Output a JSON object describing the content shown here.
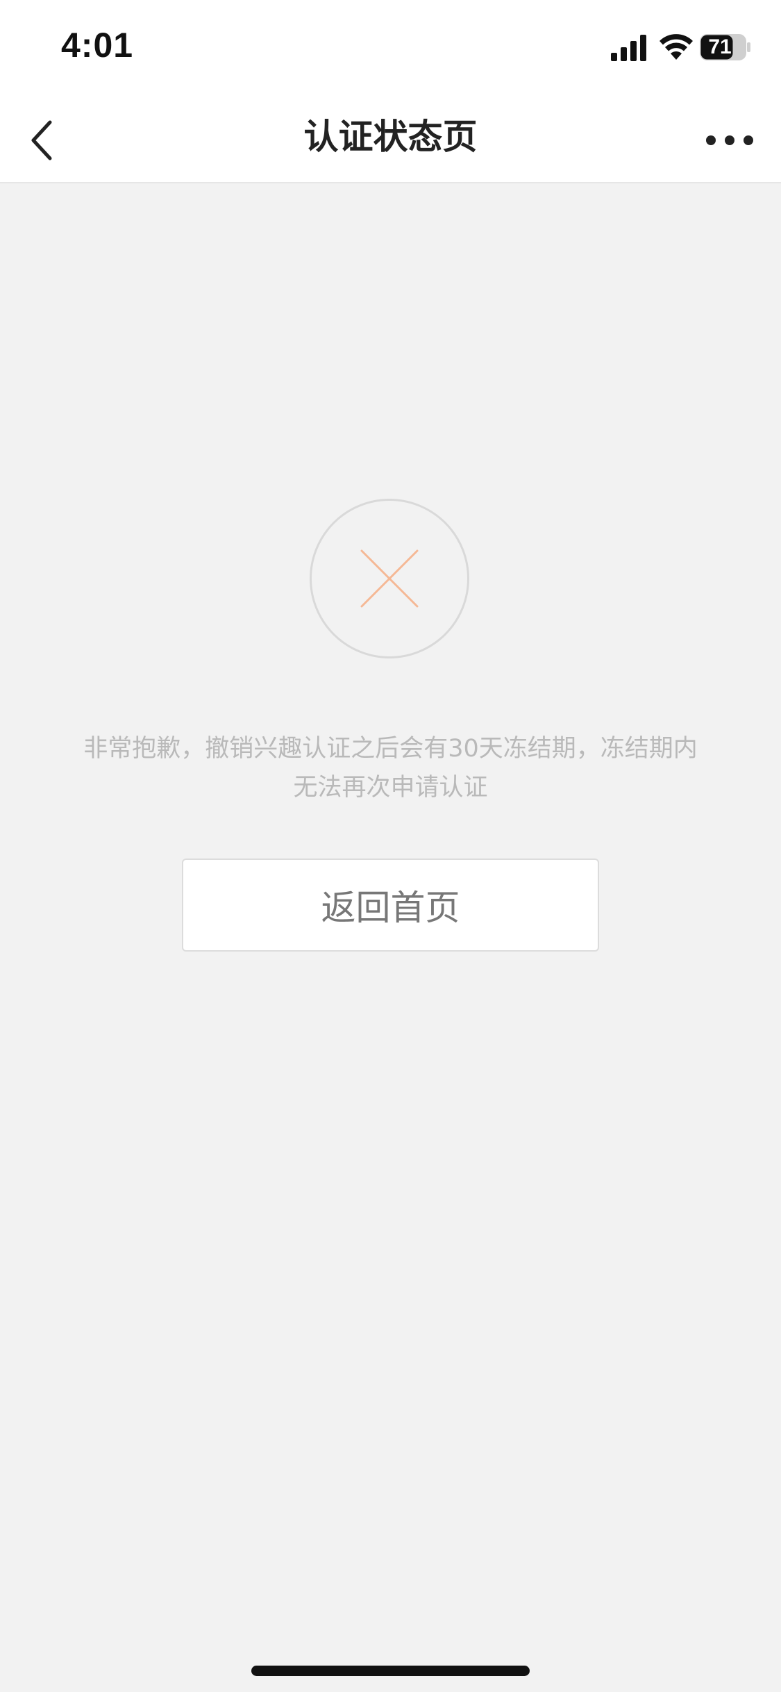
{
  "status_bar": {
    "time": "4:01",
    "battery_level": "71",
    "icons": [
      "signal-icon",
      "wifi-icon",
      "battery-icon"
    ]
  },
  "nav_bar": {
    "title": "认证状态页",
    "back_icon": "chevron-left-icon",
    "more_icon": "more-dots-icon"
  },
  "status": {
    "icon": "close-icon",
    "icon_color": "#f5b895",
    "message": "非常抱歉，撤销兴趣认证之后会有30天冻结期，冻结期内无法再次申请认证"
  },
  "actions": {
    "home_button_label": "返回首页"
  }
}
